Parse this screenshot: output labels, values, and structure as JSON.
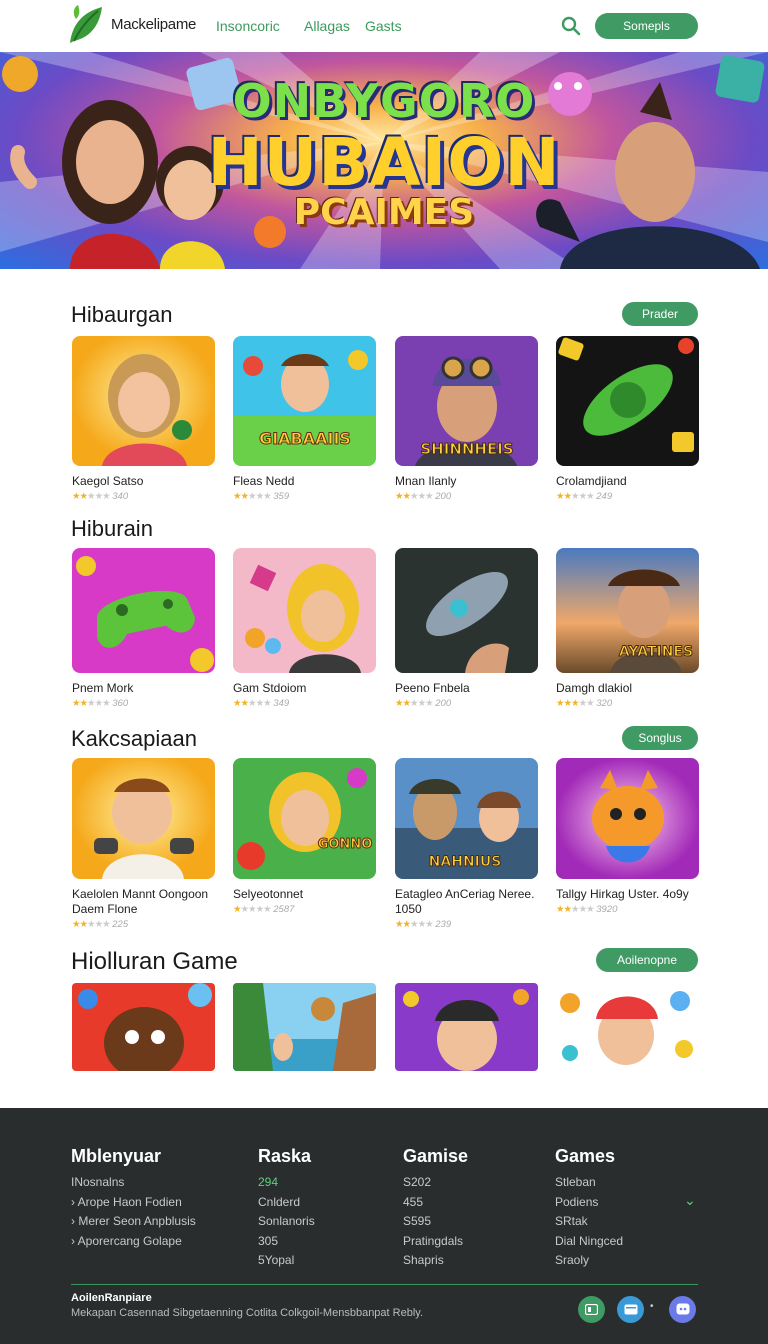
{
  "header": {
    "brand": "Mackelipame",
    "nav": [
      "Insoncoric",
      "Allagas",
      "Gasts"
    ],
    "button": "Somepls"
  },
  "hero": {
    "line1": "ONBYGORO",
    "line2": "HUBAION",
    "line3": "PCAIMES"
  },
  "sections": [
    {
      "title": "Hibaurgan",
      "button": "Prader",
      "cards": [
        {
          "title": "Kaegol Satso",
          "rating": "340",
          "stars": 2
        },
        {
          "title": "Fleas Nedd",
          "rating": "359",
          "stars": 2
        },
        {
          "title": "Mnan Ilanly",
          "rating": "200",
          "stars": 2
        },
        {
          "title": "Crolamdjiand",
          "rating": "249",
          "stars": 2
        }
      ]
    },
    {
      "title": "Hiburain",
      "button": "",
      "cards": [
        {
          "title": "Pnem Mork",
          "rating": "360",
          "stars": 2
        },
        {
          "title": "Gam Stdoiom",
          "rating": "349",
          "stars": 2
        },
        {
          "title": "Peeno Fnbela",
          "rating": "200",
          "stars": 2
        },
        {
          "title": "Damgh dlakiol",
          "rating": "320",
          "stars": 3
        }
      ]
    },
    {
      "title": "Kakcsapiaan",
      "button": "Songlus",
      "cards": [
        {
          "title": "Kaelolen Mannt Oongoon Daem Flone",
          "rating": "225",
          "stars": 2
        },
        {
          "title": "Selyeotonnet",
          "rating": "2587",
          "stars": 1
        },
        {
          "title": "Eatagleo AnCeriag Neree. 1050",
          "rating": "239",
          "stars": 2
        },
        {
          "title": "Tallgy Hirkag Uster. 4o9y",
          "rating": "3920",
          "stars": 2
        }
      ]
    },
    {
      "title": "Hiolluran Game",
      "button": "Aoilenopne",
      "cards": []
    }
  ],
  "footer": {
    "columns": [
      {
        "head": "Mblenyuar",
        "items": [
          "INosnalns",
          "Arope Haon Fodien",
          "Merer Seon Anpblusis",
          "Aporercang Golape"
        ]
      },
      {
        "head": "Raska",
        "items": [
          "294",
          "Cnlderd",
          "Sonlanoris",
          "305",
          "5Yopal"
        ]
      },
      {
        "head": "Gamise",
        "items": [
          "S202",
          "455",
          "S595",
          "Pratingdals",
          "Shapris"
        ]
      },
      {
        "head": "Games",
        "items": [
          "Stleban",
          "Podiens",
          "SRtak",
          "Dial Ningced",
          "Sraoly"
        ]
      }
    ],
    "brand": "AoilenRanpiare",
    "copyright": "Mekapan Casennad Sibgetaenning Cotlita Colkgoil-Mensbbanpat Rebly."
  },
  "colors": {
    "accent": "#3f9a63",
    "footer_bg": "#2a2d2e"
  }
}
